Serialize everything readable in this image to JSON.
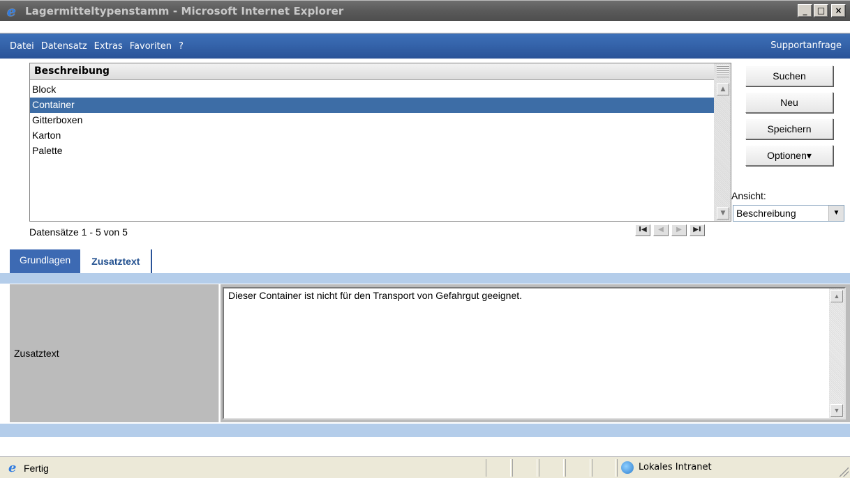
{
  "window": {
    "title": "Lagermitteltypenstamm - Microsoft Internet Explorer",
    "minimize": "_",
    "maximize": "□",
    "close": "×"
  },
  "menu": {
    "items": [
      {
        "label": "Datei"
      },
      {
        "label": "Datensatz"
      },
      {
        "label": "Extras"
      },
      {
        "label": "Favoriten"
      },
      {
        "label": "?"
      }
    ],
    "support": "Supportanfrage"
  },
  "list": {
    "header": "Beschreibung",
    "rows": [
      "Block",
      "Container",
      "Gitterboxen",
      "Karton",
      "Palette"
    ],
    "selected_index": 1,
    "count_text": "Datensätze 1 - 5 von 5"
  },
  "nav": {
    "first": "I◀",
    "prev": "◀",
    "next": "▶",
    "last": "▶I"
  },
  "actions": {
    "search": "Suchen",
    "new": "Neu",
    "save": "Speichern",
    "options": "Optionen▾"
  },
  "view": {
    "label": "Ansicht:",
    "selected": "Beschreibung"
  },
  "tabs": [
    {
      "label": "Grundlagen",
      "active": false
    },
    {
      "label": "Zusatztext",
      "active": true
    }
  ],
  "form": {
    "field_label": "Zusatztext",
    "field_value": "Dieser Container ist nicht für den Transport von Gefahrgut geeignet."
  },
  "status": {
    "text": "Fertig",
    "zone": "Lokales Intranet"
  },
  "colors": {
    "menubar": "#2a5398",
    "selection": "#3d6da6",
    "band": "#b4cdea"
  }
}
